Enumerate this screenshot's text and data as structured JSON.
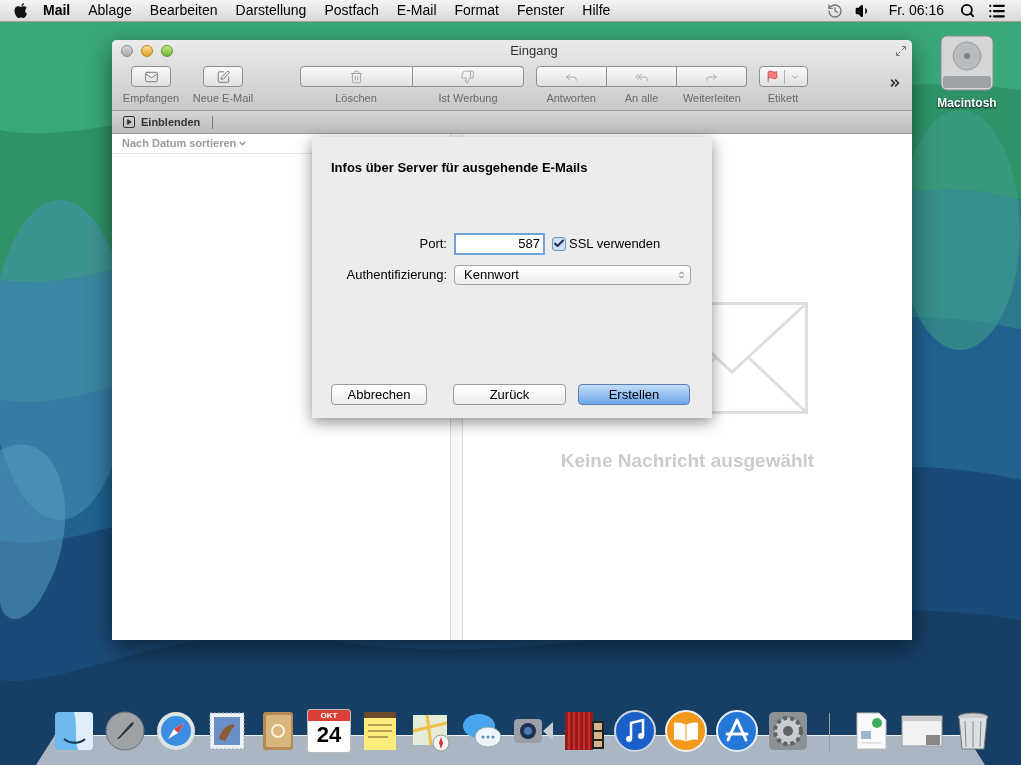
{
  "menu_bar": {
    "app": "Mail",
    "items": [
      "Ablage",
      "Bearbeiten",
      "Darstellung",
      "Postfach",
      "E-Mail",
      "Format",
      "Fenster",
      "Hilfe"
    ],
    "clock": "Fr. 06:16"
  },
  "desktop_icons": [
    {
      "label": "Macintosh"
    }
  ],
  "window": {
    "title": "Eingang",
    "toolbar": [
      {
        "kind": "single",
        "segments": [
          "Empfangen"
        ]
      },
      {
        "kind": "single",
        "segments": [
          "Neue E-Mail"
        ]
      },
      {
        "kind": "segmented",
        "segments": [
          "Löschen",
          "Ist Werbung"
        ]
      },
      {
        "kind": "segmented",
        "segments": [
          "Antworten",
          "An alle",
          "Weiterleiten"
        ]
      },
      {
        "kind": "menu",
        "segments": [
          "Etikett"
        ]
      }
    ],
    "favorites_bar": {
      "toggle": "Einblenden"
    },
    "list": {
      "sort": "Nach Datum sortieren"
    },
    "empty_message": "Keine Nachricht ausgewählt"
  },
  "sheet": {
    "title": "Infos über Server für ausgehende E-Mails",
    "fields": [
      {
        "kind": "text",
        "label": "Port:",
        "value": "587",
        "checkbox": {
          "label": "SSL verwenden",
          "checked": true
        }
      },
      {
        "kind": "select",
        "label": "Authentifizierung:",
        "value": "Kennwort"
      }
    ],
    "buttons": [
      {
        "label": "Abbrechen",
        "default": false
      },
      {
        "label": "Zurück",
        "default": false
      },
      {
        "label": "Erstellen",
        "default": true
      }
    ]
  },
  "dock": [
    {
      "kind": "finder"
    },
    {
      "kind": "launchpad"
    },
    {
      "kind": "safari"
    },
    {
      "kind": "mail"
    },
    {
      "kind": "contacts"
    },
    {
      "kind": "calendar",
      "month": "OKT",
      "day": "24"
    },
    {
      "kind": "notes"
    },
    {
      "kind": "maps"
    },
    {
      "kind": "messages"
    },
    {
      "kind": "facetime"
    },
    {
      "kind": "photobooth"
    },
    {
      "kind": "itunes"
    },
    {
      "kind": "ibooks"
    },
    {
      "kind": "appstore"
    },
    {
      "kind": "preferences"
    },
    {
      "kind": "separator"
    },
    {
      "kind": "document"
    },
    {
      "kind": "window"
    },
    {
      "kind": "trash"
    }
  ]
}
